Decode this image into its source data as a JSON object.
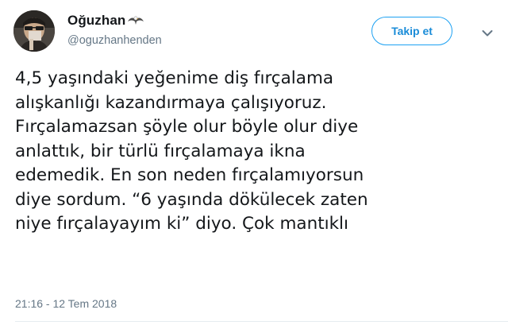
{
  "tweet": {
    "author": {
      "display_name": "Oğuzhan",
      "name_emoji": "eagle-emoji",
      "username": "@oguzhanhenden",
      "avatar_icon": "profile-photo"
    },
    "follow_button_label": "Takip et",
    "menu_icon": "chevron-down-icon",
    "text_lines": [
      "4,5 yaşındaki yeğenime diş fırçalama",
      "alışkanlığı kazandırmaya çalışıyoruz.",
      "Fırçalamazsan şöyle olur böyle olur diye",
      "anlattık, bir türlü fırçalamaya ikna",
      "edemedik. En son neden fırçalamıyorsun",
      "diye sordum. “6 yaşında dökülecek zaten",
      "niye fırçalayayım ki” diyo. Çok mantıklı"
    ],
    "timestamp": "21:16 - 12 Tem 2018"
  },
  "colors": {
    "accent": "#1da1f2",
    "text_primary": "#14171a",
    "text_secondary": "#657786"
  }
}
